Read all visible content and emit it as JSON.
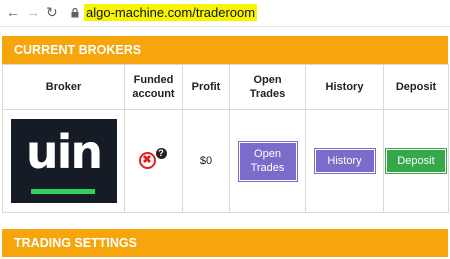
{
  "browser": {
    "url": "algo-machine.com/traderoom"
  },
  "sections": {
    "current_brokers": "CURRENT BROKERS",
    "trading_settings": "TRADING SETTINGS"
  },
  "table": {
    "headers": {
      "broker": "Broker",
      "funded_line1": "Funded",
      "funded_line2": "account",
      "profit": "Profit",
      "open_line1": "Open",
      "open_line2": "Trades",
      "history": "History",
      "deposit": "Deposit"
    },
    "row": {
      "logo_text": "uin",
      "funded_status": "not-funded",
      "profit": "$0",
      "open_trades_line1": "Open",
      "open_trades_line2": "Trades",
      "history": "History",
      "deposit": "Deposit"
    }
  },
  "colors": {
    "section_bar": "#f7a50c",
    "purple_button": "#7b6ccc",
    "green_button": "#36a84a",
    "url_highlight": "#f6f600"
  }
}
